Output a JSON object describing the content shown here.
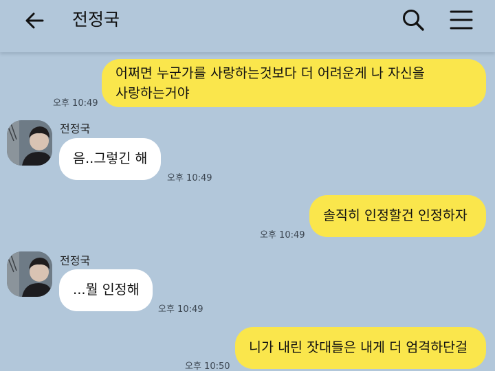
{
  "header": {
    "title": "전정국",
    "back_icon": "arrow-left-icon",
    "search_icon": "search-icon",
    "menu_icon": "hamburger-menu-icon"
  },
  "colors": {
    "background": "#b2c7da",
    "my_bubble": "#fae64c",
    "other_bubble": "#ffffff"
  },
  "messages": [
    {
      "sender": "me",
      "lines": [
        "어쩌면 누군가를 사랑하는것보다 더 어려운게 나 자신을",
        "사랑하는거야"
      ],
      "time": "오후 10:49"
    },
    {
      "sender": "other",
      "name": "전정국",
      "text": "음..그렇긴 해",
      "time": "오후 10:49"
    },
    {
      "sender": "me",
      "text": "솔직히 인정할건 인정하자",
      "time": "오후 10:49"
    },
    {
      "sender": "other",
      "name": "전정국",
      "text": "...뭘 인정해",
      "time": "오후 10:49"
    },
    {
      "sender": "me",
      "text": "니가 내린 잣대들은 내게 더 엄격하단걸",
      "time": "오후 10:50"
    }
  ]
}
